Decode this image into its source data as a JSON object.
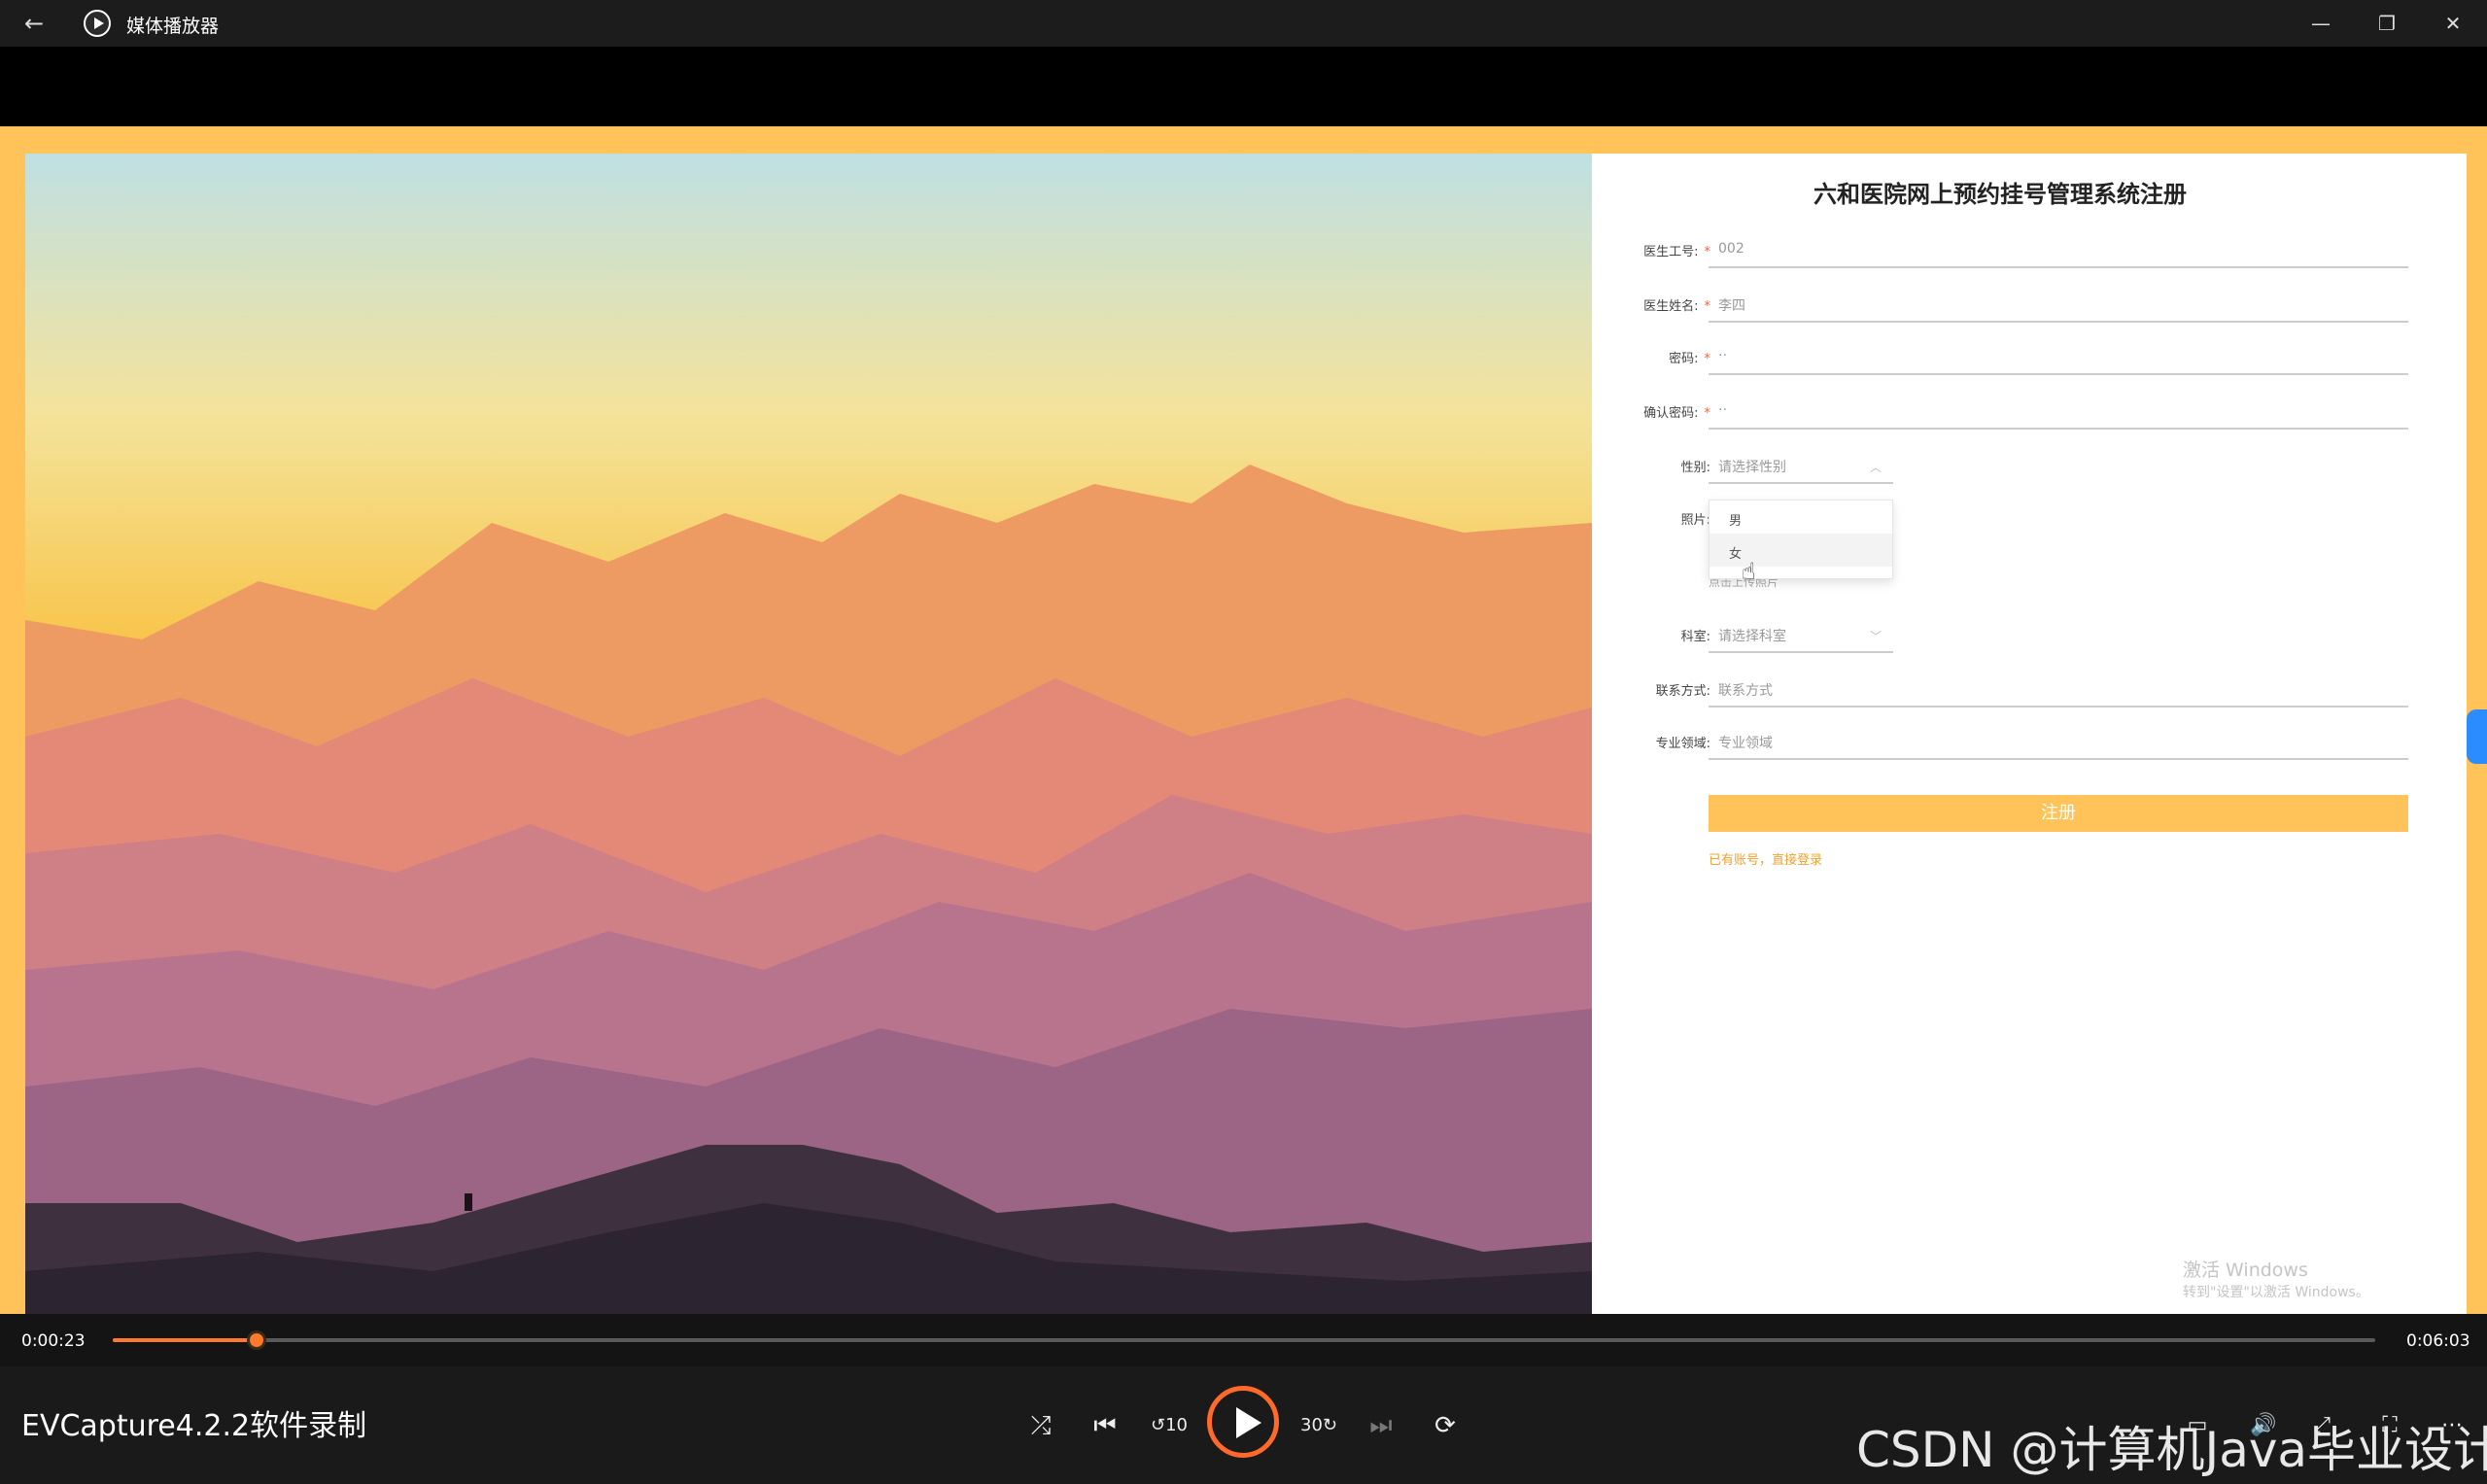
{
  "window": {
    "title": "媒体播放器"
  },
  "form": {
    "title": "六和医院网上预约挂号管理系统注册",
    "fields": [
      {
        "label": "医生工号:",
        "required": true,
        "value": "002"
      },
      {
        "label": "医生姓名:",
        "required": true,
        "value": "李四"
      },
      {
        "label": "密码:",
        "required": true,
        "value": "··"
      },
      {
        "label": "确认密码:",
        "required": true,
        "value": "··"
      }
    ],
    "gender": {
      "label": "性别:",
      "placeholder": "请选择性别",
      "options": [
        "男",
        "女"
      ],
      "highlighted": "女"
    },
    "photo": {
      "label": "照片:",
      "hint": "点击上传照片"
    },
    "department": {
      "label": "科室:",
      "placeholder": "请选择科室"
    },
    "contact": {
      "label": "联系方式:",
      "placeholder": "联系方式"
    },
    "specialty": {
      "label": "专业领域:",
      "placeholder": "专业领域"
    },
    "submit_label": "注册",
    "login_link": "已有账号，直接登录"
  },
  "activation": {
    "line1": "激活 Windows",
    "line2": "转到\"设置\"以激活 Windows。"
  },
  "player": {
    "current_time": "0:00:23",
    "total_time": "0:06:03",
    "progress": 0.0634,
    "media_title": "EVCapture4.2.2软件录制",
    "controls": [
      "shuffle-icon",
      "previous-icon",
      "rewind-10-icon",
      "play-icon",
      "forward-30-icon",
      "next-icon",
      "repeat-off-icon"
    ],
    "accent": "#ff7a2a"
  },
  "overlay_watermark": "CSDN @计算机Java毕业设计",
  "colors": {
    "form_accent": "#ffc35a",
    "required": "#e64"
  }
}
